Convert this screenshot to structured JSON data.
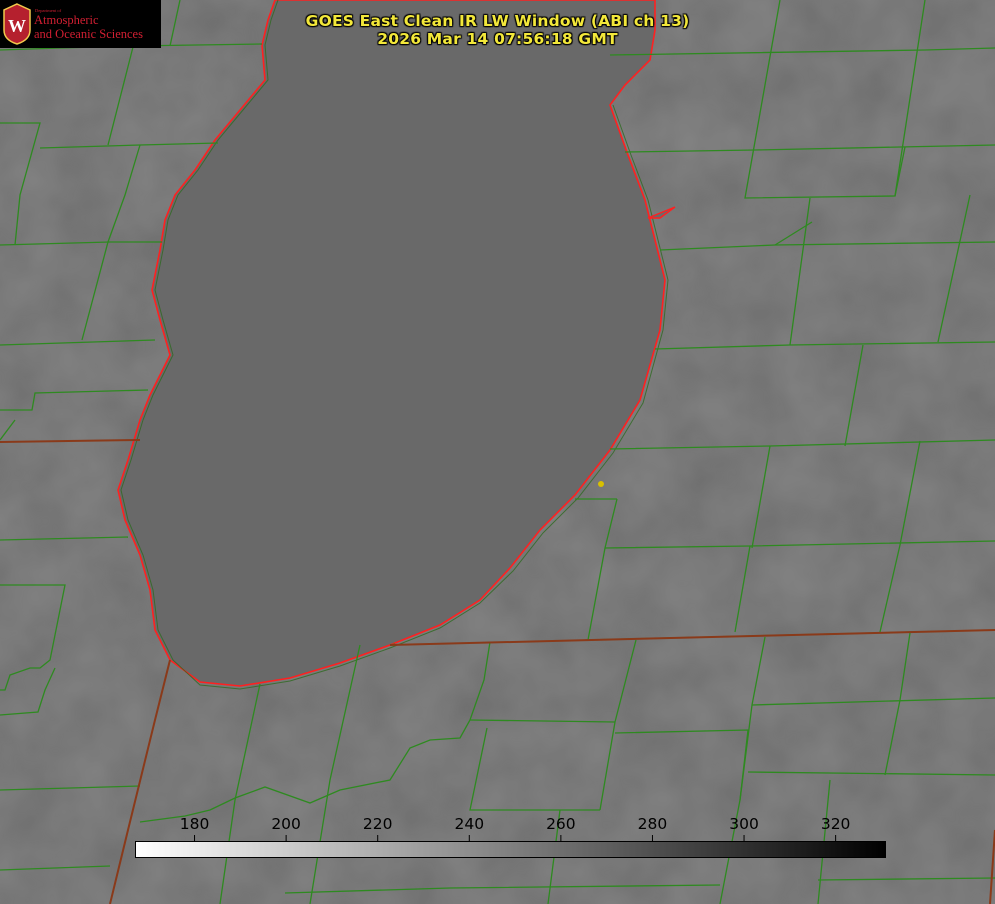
{
  "header": {
    "title_line1": "GOES East Clean IR LW Window (ABI ch 13)",
    "title_line2": "2026 Mar 14 07:56:18 GMT",
    "title_color": "#f3e83a"
  },
  "logo": {
    "seal_letter": "W",
    "department": "Department of",
    "line1": "Atmospheric",
    "line2": "and Oceanic Sciences",
    "brand_color": "#d21f32"
  },
  "colorbar": {
    "tick_labels": [
      "180",
      "200",
      "220",
      "240",
      "260",
      "280",
      "300",
      "320"
    ],
    "ticks": [
      180,
      200,
      220,
      240,
      260,
      280,
      300,
      320
    ],
    "range": [
      167,
      331
    ],
    "colormap": "white-to-black grayscale"
  },
  "map": {
    "county_line_color": "#2e8a20",
    "lake_outline_color": "#ff2020",
    "state_border_color": "#8a3a1a",
    "marker_color": "#d8c000"
  }
}
